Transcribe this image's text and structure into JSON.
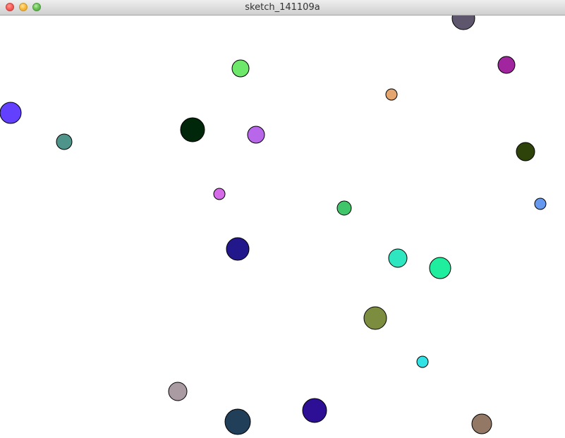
{
  "window": {
    "title": "sketch_141109a"
  },
  "controls": {
    "close_icon": "close-icon",
    "minimize_icon": "minimize-icon",
    "zoom_icon": "zoom-icon",
    "close_color": "#fc615d",
    "minimize_color": "#fdbc40",
    "zoom_color": "#6dc35a"
  },
  "canvas": {
    "background_color": "#ffffff",
    "stroke_color": "#000000",
    "circle_colors": [
      "#5d566c",
      "#6ee86a",
      "#a0259e",
      "#e5a56f",
      "#6240fd",
      "#002709",
      "#b866ea",
      "#4f948b",
      "#2d4309",
      "#d66be9",
      "#2ee7c0",
      "#41c56b",
      "#23188b",
      "#20ee9f",
      "#7d8d3f",
      "#31e3e5",
      "#aa9aa2",
      "#213f58",
      "#2d0f96",
      "#937865",
      "#6699ee",
      "#3ae63a"
    ]
  }
}
